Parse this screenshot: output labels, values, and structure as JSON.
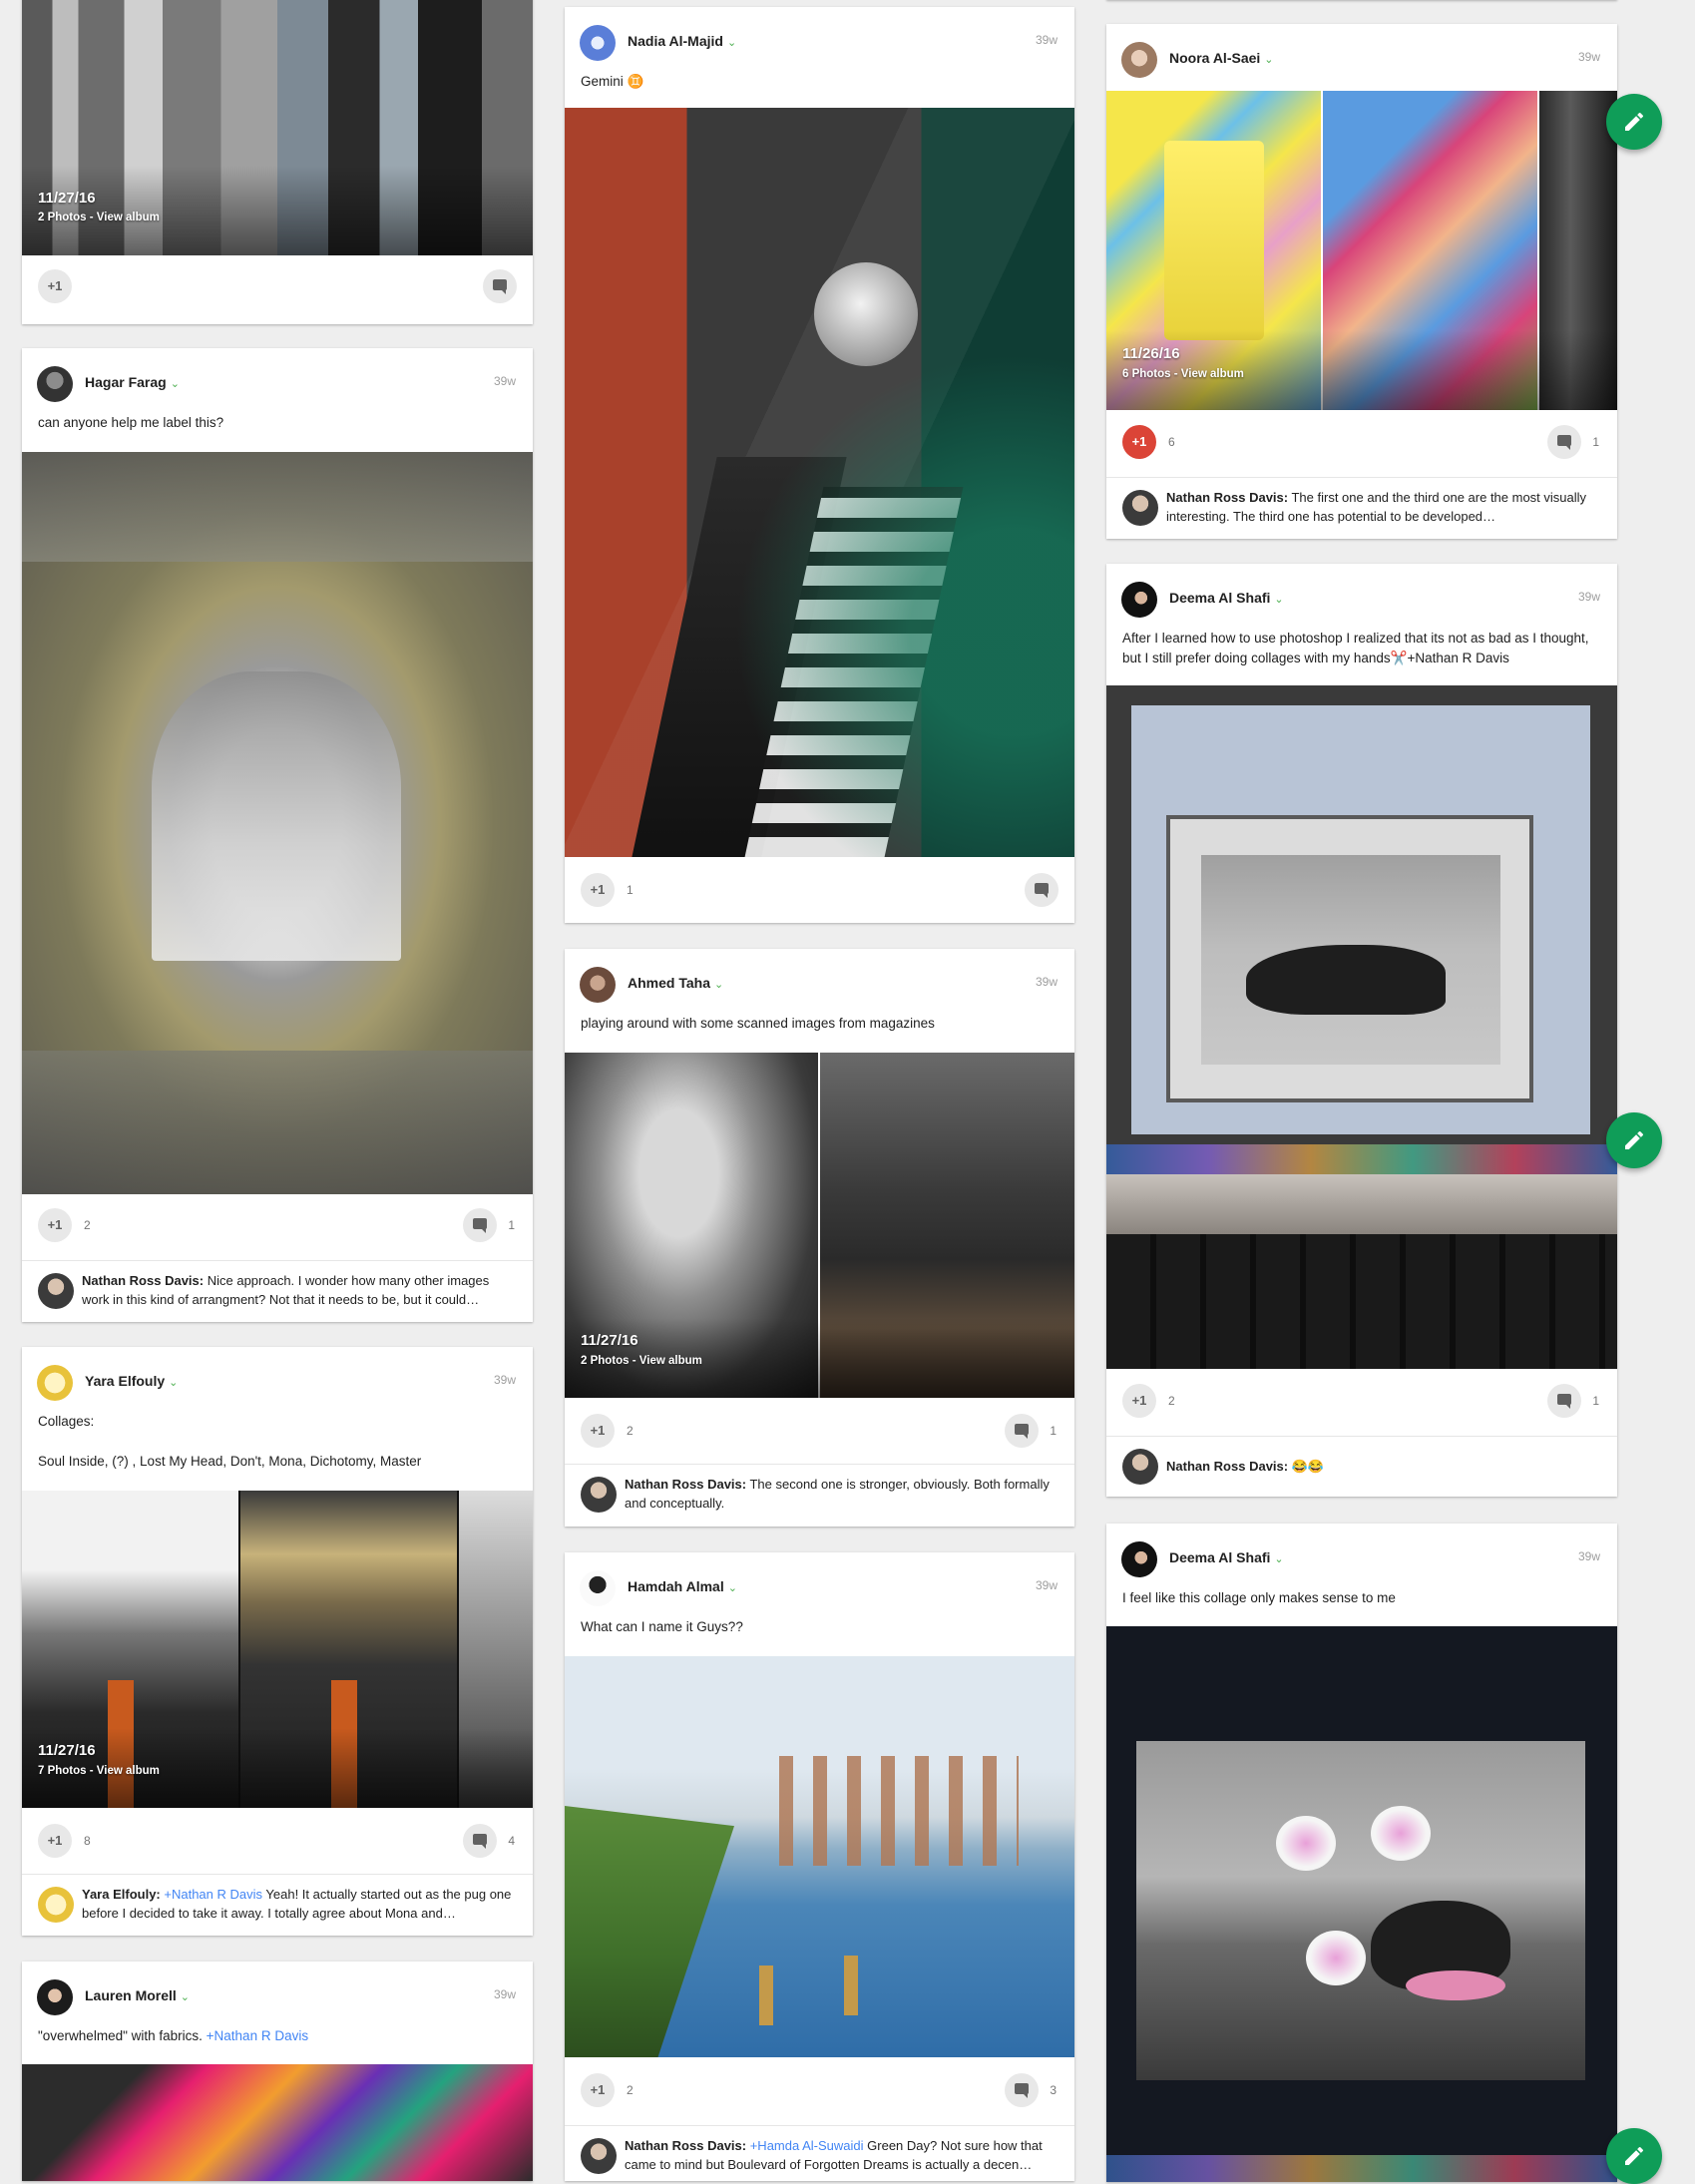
{
  "colors": {
    "background": "#eeeeee",
    "card": "#ffffff",
    "fab": "#0f9d58",
    "plus_one_active": "#db4437",
    "mention": "#4285f4",
    "chevron": "#4caf50"
  },
  "posts": {
    "p1": {
      "album_date": "11/27/16",
      "album_sub": "2 Photos - View album",
      "plus": "+1"
    },
    "p2": {
      "author": "Hagar Farag",
      "time": "39w",
      "text": "can anyone help me label this?",
      "plus": "+1",
      "plus_count": "2",
      "comment_count": "1",
      "comment": {
        "author": "Nathan Ross Davis:",
        "text": "Nice approach. I wonder how many other images work in this kind of arrangment? Not that it needs to be, but it could…"
      }
    },
    "p3": {
      "author": "Yara Elfouly",
      "time": "39w",
      "text1": "Collages:",
      "text2": "Soul Inside, (?) , Lost My Head, Don't, Mona, Dichotomy, Master",
      "album_date": "11/27/16",
      "album_sub": "7 Photos - View album",
      "plus": "+1",
      "plus_count": "8",
      "comment_count": "4",
      "comment": {
        "author": "Yara Elfouly:",
        "mention": "+Nathan R Davis",
        "text": "Yeah! It actually started out as the pug one before I decided to take it away. I totally agree about Mona and…"
      }
    },
    "p4": {
      "author": "Lauren Morell",
      "time": "39w",
      "text": "\"overwhelmed\" with fabrics. ",
      "mention": "+Nathan R Davis"
    },
    "p5": {
      "author": "Nadia Al-Majid",
      "time": "39w",
      "text": "Gemini ♊",
      "plus": "+1",
      "plus_count": "1"
    },
    "p6": {
      "author": "Ahmed Taha",
      "time": "39w",
      "text": "playing around with some scanned images from magazines",
      "album_date": "11/27/16",
      "album_sub": "2 Photos - View album",
      "plus": "+1",
      "plus_count": "2",
      "comment_count": "1",
      "comment": {
        "author": "Nathan Ross Davis:",
        "text": "The second one is stronger, obviously. Both formally and conceptually."
      }
    },
    "p7": {
      "author": "Hamdah Almal",
      "time": "39w",
      "text": "What can I name it Guys??",
      "plus": "+1",
      "plus_count": "2",
      "comment_count": "3",
      "comment": {
        "author": "Nathan Ross Davis:",
        "mention": "+Hamda Al-Suwaidi",
        "text": "Green Day? Not sure how that came to mind but Boulevard of Forgotten Dreams is actually a decen…"
      }
    },
    "p8": {
      "author": "Noora Al-Saei",
      "time": "39w",
      "album_date": "11/26/16",
      "album_sub": "6 Photos - View album",
      "plus": "+1",
      "plus_count": "6",
      "comment_count": "1",
      "comment": {
        "author": "Nathan Ross Davis:",
        "text": "The first one and the third one are the most visually interesting. The third one has potential to be developed…"
      }
    },
    "p9": {
      "author": "Deema Al Shafi",
      "time": "39w",
      "text": "After I learned how to use photoshop I realized that its not as bad as I thought, but I still prefer doing collages with my hands✂️+Nathan R Davis",
      "plus": "+1",
      "plus_count": "2",
      "comment_count": "1",
      "comment": {
        "author": "Nathan Ross Davis:",
        "text": "😂😂"
      }
    },
    "p10": {
      "author": "Deema Al Shafi",
      "time": "39w",
      "text": "I feel like this collage only makes sense to me"
    }
  },
  "icons": {
    "fab": "pencil-icon",
    "comment": "comment-icon",
    "chevron": "chevron-down-icon"
  }
}
